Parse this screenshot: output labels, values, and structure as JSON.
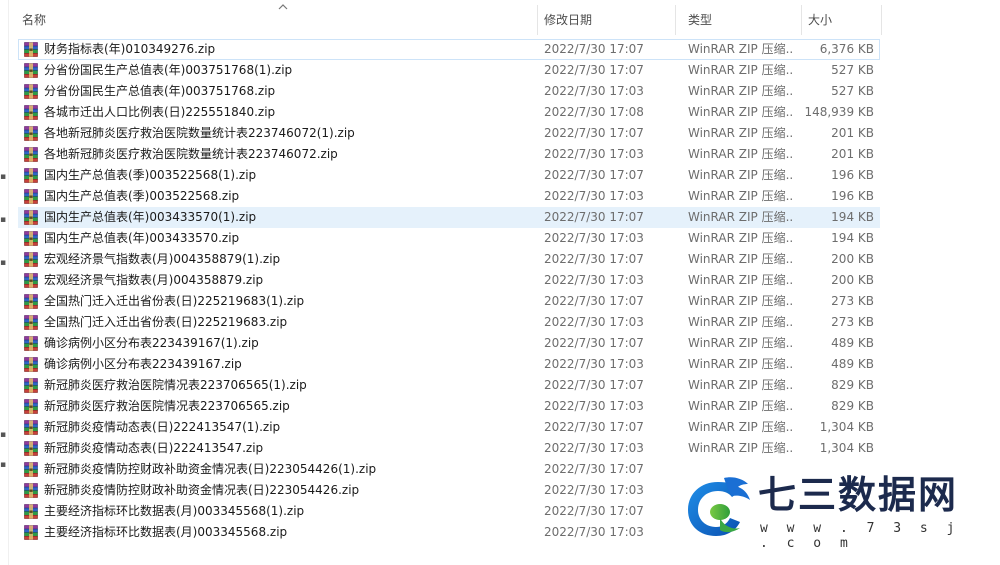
{
  "columns": {
    "name": "名称",
    "date": "修改日期",
    "type": "类型",
    "size": "大小"
  },
  "files": [
    {
      "name": "财务指标表(年)010349276.zip",
      "date": "2022/7/30 17:07",
      "type": "WinRAR ZIP 压缩...",
      "size": "6,376 KB"
    },
    {
      "name": "分省份国民生产总值表(年)003751768(1).zip",
      "date": "2022/7/30 17:07",
      "type": "WinRAR ZIP 压缩...",
      "size": "527 KB"
    },
    {
      "name": "分省份国民生产总值表(年)003751768.zip",
      "date": "2022/7/30 17:03",
      "type": "WinRAR ZIP 压缩...",
      "size": "527 KB"
    },
    {
      "name": "各城市迁出人口比例表(日)225551840.zip",
      "date": "2022/7/30 17:08",
      "type": "WinRAR ZIP 压缩...",
      "size": "148,939 KB"
    },
    {
      "name": "各地新冠肺炎医疗救治医院数量统计表223746072(1).zip",
      "date": "2022/7/30 17:07",
      "type": "WinRAR ZIP 压缩...",
      "size": "201 KB"
    },
    {
      "name": "各地新冠肺炎医疗救治医院数量统计表223746072.zip",
      "date": "2022/7/30 17:03",
      "type": "WinRAR ZIP 压缩...",
      "size": "201 KB"
    },
    {
      "name": "国内生产总值表(季)003522568(1).zip",
      "date": "2022/7/30 17:07",
      "type": "WinRAR ZIP 压缩...",
      "size": "196 KB"
    },
    {
      "name": "国内生产总值表(季)003522568.zip",
      "date": "2022/7/30 17:03",
      "type": "WinRAR ZIP 压缩...",
      "size": "196 KB"
    },
    {
      "name": "国内生产总值表(年)003433570(1).zip",
      "date": "2022/7/30 17:07",
      "type": "WinRAR ZIP 压缩...",
      "size": "194 KB"
    },
    {
      "name": "国内生产总值表(年)003433570.zip",
      "date": "2022/7/30 17:03",
      "type": "WinRAR ZIP 压缩...",
      "size": "194 KB"
    },
    {
      "name": "宏观经济景气指数表(月)004358879(1).zip",
      "date": "2022/7/30 17:07",
      "type": "WinRAR ZIP 压缩...",
      "size": "200 KB"
    },
    {
      "name": "宏观经济景气指数表(月)004358879.zip",
      "date": "2022/7/30 17:03",
      "type": "WinRAR ZIP 压缩...",
      "size": "200 KB"
    },
    {
      "name": "全国热门迁入迁出省份表(日)225219683(1).zip",
      "date": "2022/7/30 17:07",
      "type": "WinRAR ZIP 压缩...",
      "size": "273 KB"
    },
    {
      "name": "全国热门迁入迁出省份表(日)225219683.zip",
      "date": "2022/7/30 17:03",
      "type": "WinRAR ZIP 压缩...",
      "size": "273 KB"
    },
    {
      "name": "确诊病例小区分布表223439167(1).zip",
      "date": "2022/7/30 17:07",
      "type": "WinRAR ZIP 压缩...",
      "size": "489 KB"
    },
    {
      "name": "确诊病例小区分布表223439167.zip",
      "date": "2022/7/30 17:03",
      "type": "WinRAR ZIP 压缩...",
      "size": "489 KB"
    },
    {
      "name": "新冠肺炎医疗救治医院情况表223706565(1).zip",
      "date": "2022/7/30 17:07",
      "type": "WinRAR ZIP 压缩...",
      "size": "829 KB"
    },
    {
      "name": "新冠肺炎医疗救治医院情况表223706565.zip",
      "date": "2022/7/30 17:03",
      "type": "WinRAR ZIP 压缩...",
      "size": "829 KB"
    },
    {
      "name": "新冠肺炎疫情动态表(日)222413547(1).zip",
      "date": "2022/7/30 17:07",
      "type": "WinRAR ZIP 压缩...",
      "size": "1,304 KB"
    },
    {
      "name": "新冠肺炎疫情动态表(日)222413547.zip",
      "date": "2022/7/30 17:03",
      "type": "WinRAR ZIP 压缩...",
      "size": "1,304 KB"
    },
    {
      "name": "新冠肺炎疫情防控财政补助资金情况表(日)223054426(1).zip",
      "date": "2022/7/30 17:07",
      "type": "",
      "size": ""
    },
    {
      "name": "新冠肺炎疫情防控财政补助资金情况表(日)223054426.zip",
      "date": "2022/7/30 17:03",
      "type": "",
      "size": ""
    },
    {
      "name": "主要经济指标环比数据表(月)003345568(1).zip",
      "date": "2022/7/30 17:07",
      "type": "",
      "size": ""
    },
    {
      "name": "主要经济指标环比数据表(月)003345568.zip",
      "date": "2022/7/30 17:03",
      "type": "",
      "size": ""
    }
  ],
  "selected_index": 8,
  "logo": {
    "title": "七三数据网",
    "url": "w w w . 7 3 s j . c o m"
  },
  "colors": {
    "selected_row": "#e5f1fb",
    "header_text": "#4d4d4d",
    "meta_text": "#6d6d6d",
    "logo_text": "#1c2a4d"
  }
}
